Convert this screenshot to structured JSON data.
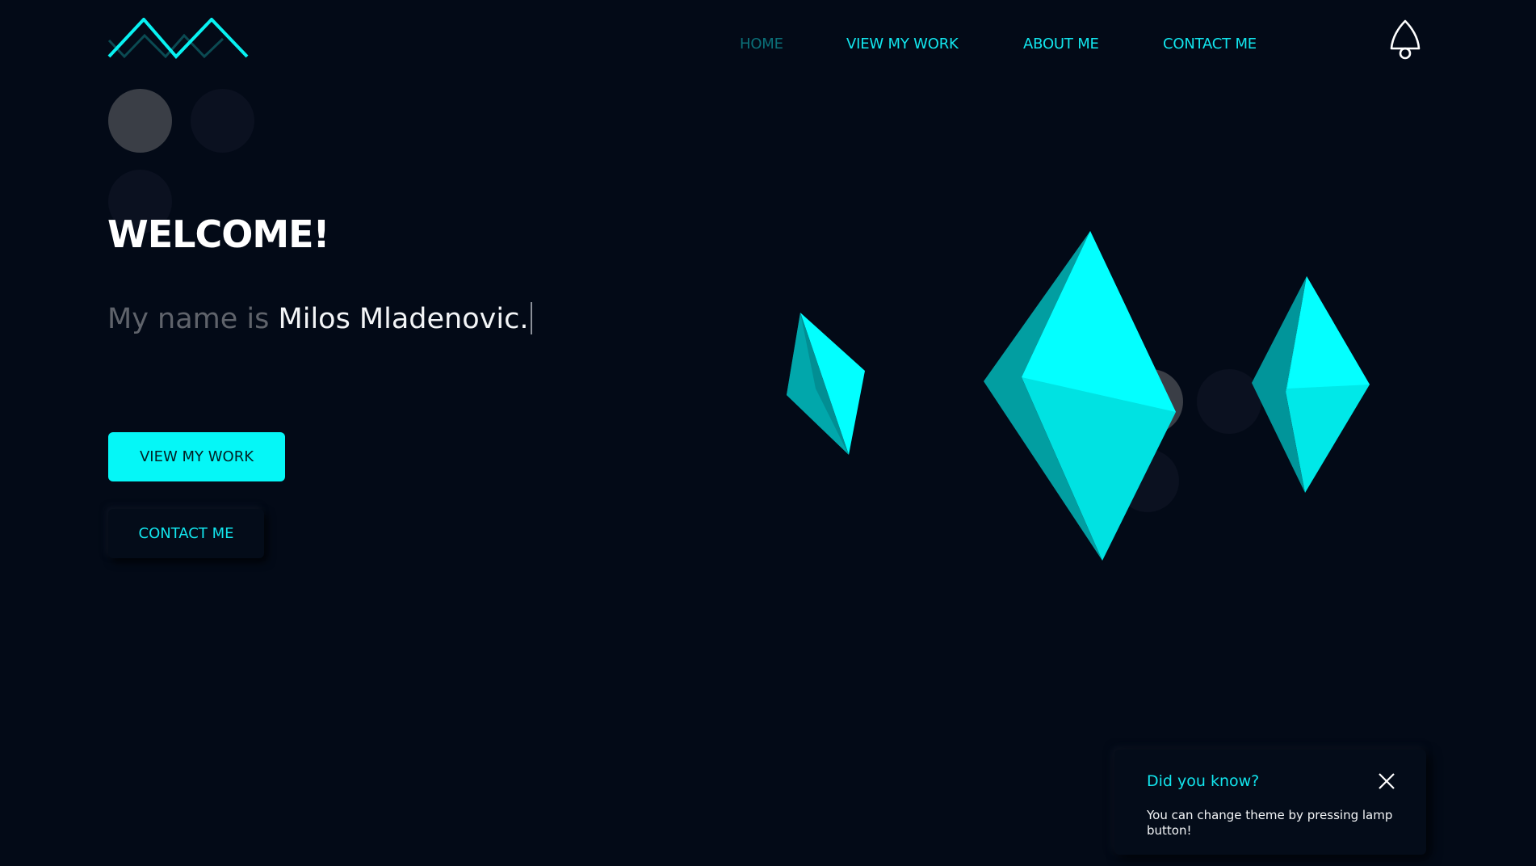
{
  "nav": {
    "home": "HOME",
    "work": "VIEW MY WORK",
    "about": "ABOUT ME",
    "contact": "CONTACT ME"
  },
  "hero": {
    "title": "WELCOME!",
    "intro_prefix": "My name is ",
    "name": "Milos Mladenovic."
  },
  "buttons": {
    "view_work": "VIEW MY WORK",
    "contact": "CONTACT ME"
  },
  "toast": {
    "title": "Did you know?",
    "body": "You can change theme by pressing lamp button!"
  },
  "icons": {
    "logo": "zigzag-logo-icon",
    "lamp": "lamp-icon",
    "close": "close-icon"
  },
  "colors": {
    "background": "#030a17",
    "accent": "#00f5f5",
    "accent_dark": "#0b6f78",
    "text": "#ffffff",
    "muted": "#5f636b"
  }
}
